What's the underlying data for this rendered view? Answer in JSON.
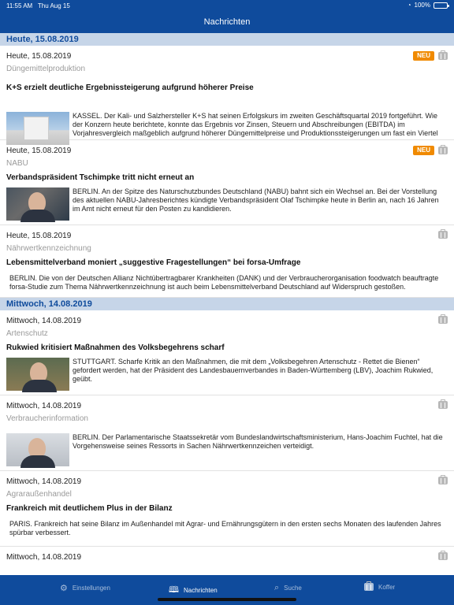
{
  "status_bar": {
    "time": "11:55 AM",
    "date": "Thu Aug 15",
    "battery": "100%"
  },
  "nav": {
    "title": "Nachrichten"
  },
  "days": [
    {
      "header": "Heute, 15.08.2019",
      "items": [
        {
          "date": "Heute, 15.08.2019",
          "category": "Düngemittelproduktion",
          "badge": "NEU",
          "headline": "K+S erzielt deutliche Ergebnissteigerung aufgrund höherer Preise",
          "text": "KASSEL. Der Kali- und Salzhersteller K+S hat seinen Erfolgskurs im zweiten Geschäftsquartal 2019 fortgeführt. Wie der Konzern heute berichtete, konnte das Ergebnis vor Zinsen, Steuern und Abschreibungen (EBITDA) im Vorjahresvergleich maßgeblich aufgrund höherer Düngemittelpreise und Produktionssteigerungen um fast ein Viertel"
        },
        {
          "date": "Heute, 15.08.2019",
          "category": "NABU",
          "badge": "NEU",
          "headline": "Verbandspräsident Tschimpke tritt nicht erneut an",
          "text": "BERLIN. An der Spitze des Naturschutzbundes Deutschland (NABU) bahnt sich ein Wechsel an. Bei der Vorstellung des aktuellen NABU-Jahresberichtes kündigte Verbandspräsident Olaf Tschimpke heute in Berlin an, nach 16 Jahren im Amt nicht erneut für den Posten zu kandidieren."
        },
        {
          "date": "Heute, 15.08.2019",
          "category": "Nährwertkennzeichnung",
          "headline": "Lebensmittelverband moniert „suggestive Fragestellungen“ bei forsa-Umfrage",
          "text": "BERLIN. Die von der Deutschen Allianz Nichtübertragbarer Krankheiten (DANK) und der Verbraucherorganisation foodwatch beauftragte forsa-Studie zum Thema Nährwertkennzeichnung ist auch beim Lebensmittelverband Deutschland auf Widerspruch gestoßen."
        }
      ]
    },
    {
      "header": "Mittwoch, 14.08.2019",
      "items": [
        {
          "date": "Mittwoch, 14.08.2019",
          "category": "Artenschutz",
          "headline": "Rukwied kritisiert Maßnahmen des Volksbegehrens scharf",
          "text": "STUTTGART. Scharfe Kritik an den Maßnahmen, die mit dem „Volksbegehren Artenschutz - Rettet die Bienen“ gefordert werden, hat der Präsident des Landesbauernverbandes in Baden-Württemberg (LBV), Joachim Rukwied, geübt."
        },
        {
          "date": "Mittwoch, 14.08.2019",
          "category": "Verbraucherinformation",
          "text": "BERLIN. Der Parlamentarische Staatssekretär vom Bundeslandwirtschaftsministerium, Hans-Joachim Fuchtel, hat die Vorgehensweise seines Ressorts in Sachen Nährwertkennzeichen verteidigt."
        },
        {
          "date": "Mittwoch, 14.08.2019",
          "category": "Agraraußenhandel",
          "headline": "Frankreich mit deutlichem Plus in der Bilanz",
          "text": "PARIS. Frankreich hat seine Bilanz im Außenhandel mit Agrar- und Ernährungsgütern in den ersten sechs Monaten des laufenden Jahres spürbar verbessert."
        },
        {
          "date": "Mittwoch, 14.08.2019"
        }
      ]
    }
  ],
  "tabbar": {
    "tabs": [
      {
        "label": "Einstellungen",
        "icon": "gear-icon"
      },
      {
        "label": "Nachrichten",
        "icon": "book-icon"
      },
      {
        "label": "Suche",
        "icon": "search-icon"
      },
      {
        "label": "Koffer",
        "icon": "briefcase-icon"
      }
    ]
  },
  "colors": {
    "bar": "#0f4b9c",
    "day_header_bg": "#c6d5e8",
    "badge": "#f08a00"
  }
}
